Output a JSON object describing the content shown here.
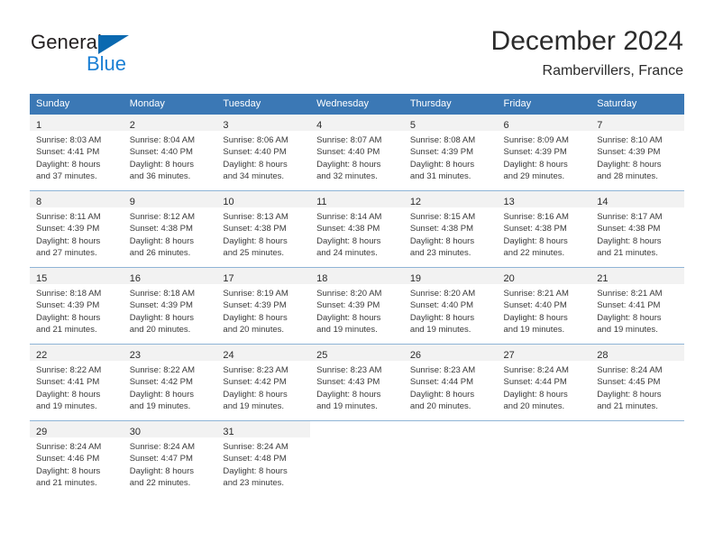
{
  "brand": {
    "name_top": "General",
    "name_bottom": "Blue",
    "triangle_color": "#0b69b0",
    "blue_text_color": "#1a7fd4"
  },
  "header": {
    "title": "December 2024",
    "subtitle": "Rambervillers, France"
  },
  "theme": {
    "header_bg": "#3b78b5",
    "header_text": "#ffffff",
    "daynum_band_bg": "#f2f2f2",
    "week_divider": "#8fb4d6",
    "body_text": "#3a3a3a"
  },
  "calendar": {
    "weekday_headers": [
      "Sunday",
      "Monday",
      "Tuesday",
      "Wednesday",
      "Thursday",
      "Friday",
      "Saturday"
    ],
    "weeks": [
      [
        {
          "day": "1",
          "sunrise": "Sunrise: 8:03 AM",
          "sunset": "Sunset: 4:41 PM",
          "daylight1": "Daylight: 8 hours",
          "daylight2": "and 37 minutes."
        },
        {
          "day": "2",
          "sunrise": "Sunrise: 8:04 AM",
          "sunset": "Sunset: 4:40 PM",
          "daylight1": "Daylight: 8 hours",
          "daylight2": "and 36 minutes."
        },
        {
          "day": "3",
          "sunrise": "Sunrise: 8:06 AM",
          "sunset": "Sunset: 4:40 PM",
          "daylight1": "Daylight: 8 hours",
          "daylight2": "and 34 minutes."
        },
        {
          "day": "4",
          "sunrise": "Sunrise: 8:07 AM",
          "sunset": "Sunset: 4:40 PM",
          "daylight1": "Daylight: 8 hours",
          "daylight2": "and 32 minutes."
        },
        {
          "day": "5",
          "sunrise": "Sunrise: 8:08 AM",
          "sunset": "Sunset: 4:39 PM",
          "daylight1": "Daylight: 8 hours",
          "daylight2": "and 31 minutes."
        },
        {
          "day": "6",
          "sunrise": "Sunrise: 8:09 AM",
          "sunset": "Sunset: 4:39 PM",
          "daylight1": "Daylight: 8 hours",
          "daylight2": "and 29 minutes."
        },
        {
          "day": "7",
          "sunrise": "Sunrise: 8:10 AM",
          "sunset": "Sunset: 4:39 PM",
          "daylight1": "Daylight: 8 hours",
          "daylight2": "and 28 minutes."
        }
      ],
      [
        {
          "day": "8",
          "sunrise": "Sunrise: 8:11 AM",
          "sunset": "Sunset: 4:39 PM",
          "daylight1": "Daylight: 8 hours",
          "daylight2": "and 27 minutes."
        },
        {
          "day": "9",
          "sunrise": "Sunrise: 8:12 AM",
          "sunset": "Sunset: 4:38 PM",
          "daylight1": "Daylight: 8 hours",
          "daylight2": "and 26 minutes."
        },
        {
          "day": "10",
          "sunrise": "Sunrise: 8:13 AM",
          "sunset": "Sunset: 4:38 PM",
          "daylight1": "Daylight: 8 hours",
          "daylight2": "and 25 minutes."
        },
        {
          "day": "11",
          "sunrise": "Sunrise: 8:14 AM",
          "sunset": "Sunset: 4:38 PM",
          "daylight1": "Daylight: 8 hours",
          "daylight2": "and 24 minutes."
        },
        {
          "day": "12",
          "sunrise": "Sunrise: 8:15 AM",
          "sunset": "Sunset: 4:38 PM",
          "daylight1": "Daylight: 8 hours",
          "daylight2": "and 23 minutes."
        },
        {
          "day": "13",
          "sunrise": "Sunrise: 8:16 AM",
          "sunset": "Sunset: 4:38 PM",
          "daylight1": "Daylight: 8 hours",
          "daylight2": "and 22 minutes."
        },
        {
          "day": "14",
          "sunrise": "Sunrise: 8:17 AM",
          "sunset": "Sunset: 4:38 PM",
          "daylight1": "Daylight: 8 hours",
          "daylight2": "and 21 minutes."
        }
      ],
      [
        {
          "day": "15",
          "sunrise": "Sunrise: 8:18 AM",
          "sunset": "Sunset: 4:39 PM",
          "daylight1": "Daylight: 8 hours",
          "daylight2": "and 21 minutes."
        },
        {
          "day": "16",
          "sunrise": "Sunrise: 8:18 AM",
          "sunset": "Sunset: 4:39 PM",
          "daylight1": "Daylight: 8 hours",
          "daylight2": "and 20 minutes."
        },
        {
          "day": "17",
          "sunrise": "Sunrise: 8:19 AM",
          "sunset": "Sunset: 4:39 PM",
          "daylight1": "Daylight: 8 hours",
          "daylight2": "and 20 minutes."
        },
        {
          "day": "18",
          "sunrise": "Sunrise: 8:20 AM",
          "sunset": "Sunset: 4:39 PM",
          "daylight1": "Daylight: 8 hours",
          "daylight2": "and 19 minutes."
        },
        {
          "day": "19",
          "sunrise": "Sunrise: 8:20 AM",
          "sunset": "Sunset: 4:40 PM",
          "daylight1": "Daylight: 8 hours",
          "daylight2": "and 19 minutes."
        },
        {
          "day": "20",
          "sunrise": "Sunrise: 8:21 AM",
          "sunset": "Sunset: 4:40 PM",
          "daylight1": "Daylight: 8 hours",
          "daylight2": "and 19 minutes."
        },
        {
          "day": "21",
          "sunrise": "Sunrise: 8:21 AM",
          "sunset": "Sunset: 4:41 PM",
          "daylight1": "Daylight: 8 hours",
          "daylight2": "and 19 minutes."
        }
      ],
      [
        {
          "day": "22",
          "sunrise": "Sunrise: 8:22 AM",
          "sunset": "Sunset: 4:41 PM",
          "daylight1": "Daylight: 8 hours",
          "daylight2": "and 19 minutes."
        },
        {
          "day": "23",
          "sunrise": "Sunrise: 8:22 AM",
          "sunset": "Sunset: 4:42 PM",
          "daylight1": "Daylight: 8 hours",
          "daylight2": "and 19 minutes."
        },
        {
          "day": "24",
          "sunrise": "Sunrise: 8:23 AM",
          "sunset": "Sunset: 4:42 PM",
          "daylight1": "Daylight: 8 hours",
          "daylight2": "and 19 minutes."
        },
        {
          "day": "25",
          "sunrise": "Sunrise: 8:23 AM",
          "sunset": "Sunset: 4:43 PM",
          "daylight1": "Daylight: 8 hours",
          "daylight2": "and 19 minutes."
        },
        {
          "day": "26",
          "sunrise": "Sunrise: 8:23 AM",
          "sunset": "Sunset: 4:44 PM",
          "daylight1": "Daylight: 8 hours",
          "daylight2": "and 20 minutes."
        },
        {
          "day": "27",
          "sunrise": "Sunrise: 8:24 AM",
          "sunset": "Sunset: 4:44 PM",
          "daylight1": "Daylight: 8 hours",
          "daylight2": "and 20 minutes."
        },
        {
          "day": "28",
          "sunrise": "Sunrise: 8:24 AM",
          "sunset": "Sunset: 4:45 PM",
          "daylight1": "Daylight: 8 hours",
          "daylight2": "and 21 minutes."
        }
      ],
      [
        {
          "day": "29",
          "sunrise": "Sunrise: 8:24 AM",
          "sunset": "Sunset: 4:46 PM",
          "daylight1": "Daylight: 8 hours",
          "daylight2": "and 21 minutes."
        },
        {
          "day": "30",
          "sunrise": "Sunrise: 8:24 AM",
          "sunset": "Sunset: 4:47 PM",
          "daylight1": "Daylight: 8 hours",
          "daylight2": "and 22 minutes."
        },
        {
          "day": "31",
          "sunrise": "Sunrise: 8:24 AM",
          "sunset": "Sunset: 4:48 PM",
          "daylight1": "Daylight: 8 hours",
          "daylight2": "and 23 minutes."
        },
        {
          "day": "",
          "sunrise": "",
          "sunset": "",
          "daylight1": "",
          "daylight2": ""
        },
        {
          "day": "",
          "sunrise": "",
          "sunset": "",
          "daylight1": "",
          "daylight2": ""
        },
        {
          "day": "",
          "sunrise": "",
          "sunset": "",
          "daylight1": "",
          "daylight2": ""
        },
        {
          "day": "",
          "sunrise": "",
          "sunset": "",
          "daylight1": "",
          "daylight2": ""
        }
      ]
    ]
  }
}
